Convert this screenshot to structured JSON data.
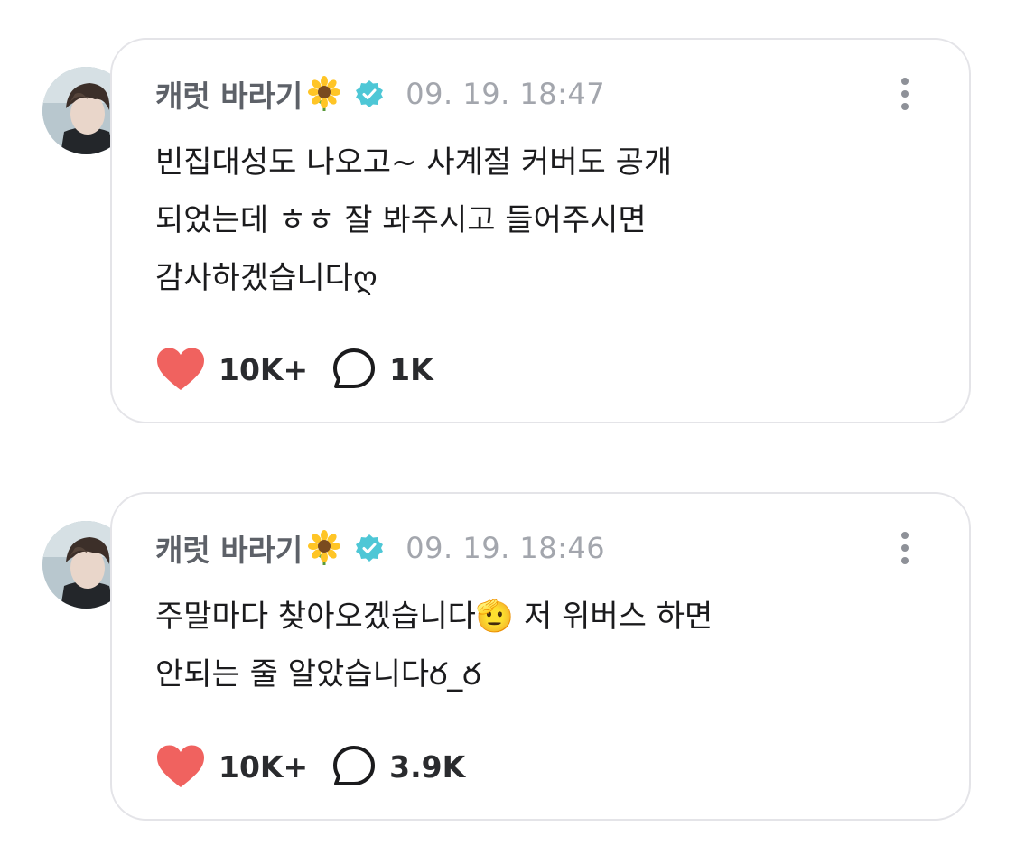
{
  "posts": [
    {
      "author": "캐럿 바라기",
      "author_emoji_icon": "sunflower-icon",
      "verified_icon": "verified-badge-icon",
      "timestamp": "09. 19. 18:47",
      "lines": [
        "빈집대성도 나오고~ 사계절 커버도 공개",
        "되었는데 ㅎㅎ 잘 봐주시고 들어주시면",
        "감사하겠습니다ღ"
      ],
      "likes": "10K+",
      "comments": "1K"
    },
    {
      "author": "캐럿 바라기",
      "author_emoji_icon": "sunflower-icon",
      "verified_icon": "verified-badge-icon",
      "timestamp": "09. 19. 18:46",
      "lines": [
        "주말마다 찾아오겠습니다🫡 저 위버스 하면",
        "안되는 줄 알았습니다ర_ర"
      ],
      "likes": "10K+",
      "comments": "3.9K"
    }
  ],
  "colors": {
    "heart": "#f0625f",
    "verified": "#4ec7d6",
    "card_border": "#e4e4e8",
    "author": "#5d6168",
    "timestamp": "#a3a6ad"
  }
}
